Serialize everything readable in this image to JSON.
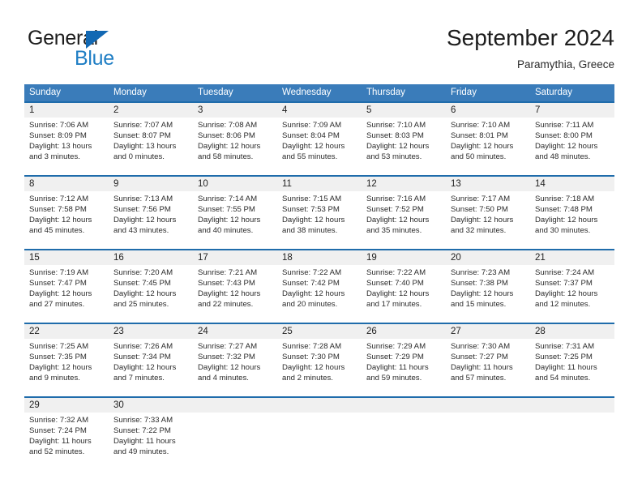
{
  "brand": {
    "name_part1": "General",
    "name_part2": "Blue",
    "logo_color": "#1268b3"
  },
  "header": {
    "title": "September 2024",
    "location": "Paramythia, Greece"
  },
  "theme": {
    "header_blue": "#3a7cba",
    "separator_blue": "#1f6cab",
    "daynum_band": "#f0f0f0"
  },
  "weekdays": [
    "Sunday",
    "Monday",
    "Tuesday",
    "Wednesday",
    "Thursday",
    "Friday",
    "Saturday"
  ],
  "weeks": [
    {
      "days": [
        {
          "num": "1",
          "sunrise": "Sunrise: 7:06 AM",
          "sunset": "Sunset: 8:09 PM",
          "daylight": "Daylight: 13 hours and 3 minutes."
        },
        {
          "num": "2",
          "sunrise": "Sunrise: 7:07 AM",
          "sunset": "Sunset: 8:07 PM",
          "daylight": "Daylight: 13 hours and 0 minutes."
        },
        {
          "num": "3",
          "sunrise": "Sunrise: 7:08 AM",
          "sunset": "Sunset: 8:06 PM",
          "daylight": "Daylight: 12 hours and 58 minutes."
        },
        {
          "num": "4",
          "sunrise": "Sunrise: 7:09 AM",
          "sunset": "Sunset: 8:04 PM",
          "daylight": "Daylight: 12 hours and 55 minutes."
        },
        {
          "num": "5",
          "sunrise": "Sunrise: 7:10 AM",
          "sunset": "Sunset: 8:03 PM",
          "daylight": "Daylight: 12 hours and 53 minutes."
        },
        {
          "num": "6",
          "sunrise": "Sunrise: 7:10 AM",
          "sunset": "Sunset: 8:01 PM",
          "daylight": "Daylight: 12 hours and 50 minutes."
        },
        {
          "num": "7",
          "sunrise": "Sunrise: 7:11 AM",
          "sunset": "Sunset: 8:00 PM",
          "daylight": "Daylight: 12 hours and 48 minutes."
        }
      ]
    },
    {
      "days": [
        {
          "num": "8",
          "sunrise": "Sunrise: 7:12 AM",
          "sunset": "Sunset: 7:58 PM",
          "daylight": "Daylight: 12 hours and 45 minutes."
        },
        {
          "num": "9",
          "sunrise": "Sunrise: 7:13 AM",
          "sunset": "Sunset: 7:56 PM",
          "daylight": "Daylight: 12 hours and 43 minutes."
        },
        {
          "num": "10",
          "sunrise": "Sunrise: 7:14 AM",
          "sunset": "Sunset: 7:55 PM",
          "daylight": "Daylight: 12 hours and 40 minutes."
        },
        {
          "num": "11",
          "sunrise": "Sunrise: 7:15 AM",
          "sunset": "Sunset: 7:53 PM",
          "daylight": "Daylight: 12 hours and 38 minutes."
        },
        {
          "num": "12",
          "sunrise": "Sunrise: 7:16 AM",
          "sunset": "Sunset: 7:52 PM",
          "daylight": "Daylight: 12 hours and 35 minutes."
        },
        {
          "num": "13",
          "sunrise": "Sunrise: 7:17 AM",
          "sunset": "Sunset: 7:50 PM",
          "daylight": "Daylight: 12 hours and 32 minutes."
        },
        {
          "num": "14",
          "sunrise": "Sunrise: 7:18 AM",
          "sunset": "Sunset: 7:48 PM",
          "daylight": "Daylight: 12 hours and 30 minutes."
        }
      ]
    },
    {
      "days": [
        {
          "num": "15",
          "sunrise": "Sunrise: 7:19 AM",
          "sunset": "Sunset: 7:47 PM",
          "daylight": "Daylight: 12 hours and 27 minutes."
        },
        {
          "num": "16",
          "sunrise": "Sunrise: 7:20 AM",
          "sunset": "Sunset: 7:45 PM",
          "daylight": "Daylight: 12 hours and 25 minutes."
        },
        {
          "num": "17",
          "sunrise": "Sunrise: 7:21 AM",
          "sunset": "Sunset: 7:43 PM",
          "daylight": "Daylight: 12 hours and 22 minutes."
        },
        {
          "num": "18",
          "sunrise": "Sunrise: 7:22 AM",
          "sunset": "Sunset: 7:42 PM",
          "daylight": "Daylight: 12 hours and 20 minutes."
        },
        {
          "num": "19",
          "sunrise": "Sunrise: 7:22 AM",
          "sunset": "Sunset: 7:40 PM",
          "daylight": "Daylight: 12 hours and 17 minutes."
        },
        {
          "num": "20",
          "sunrise": "Sunrise: 7:23 AM",
          "sunset": "Sunset: 7:38 PM",
          "daylight": "Daylight: 12 hours and 15 minutes."
        },
        {
          "num": "21",
          "sunrise": "Sunrise: 7:24 AM",
          "sunset": "Sunset: 7:37 PM",
          "daylight": "Daylight: 12 hours and 12 minutes."
        }
      ]
    },
    {
      "days": [
        {
          "num": "22",
          "sunrise": "Sunrise: 7:25 AM",
          "sunset": "Sunset: 7:35 PM",
          "daylight": "Daylight: 12 hours and 9 minutes."
        },
        {
          "num": "23",
          "sunrise": "Sunrise: 7:26 AM",
          "sunset": "Sunset: 7:34 PM",
          "daylight": "Daylight: 12 hours and 7 minutes."
        },
        {
          "num": "24",
          "sunrise": "Sunrise: 7:27 AM",
          "sunset": "Sunset: 7:32 PM",
          "daylight": "Daylight: 12 hours and 4 minutes."
        },
        {
          "num": "25",
          "sunrise": "Sunrise: 7:28 AM",
          "sunset": "Sunset: 7:30 PM",
          "daylight": "Daylight: 12 hours and 2 minutes."
        },
        {
          "num": "26",
          "sunrise": "Sunrise: 7:29 AM",
          "sunset": "Sunset: 7:29 PM",
          "daylight": "Daylight: 11 hours and 59 minutes."
        },
        {
          "num": "27",
          "sunrise": "Sunrise: 7:30 AM",
          "sunset": "Sunset: 7:27 PM",
          "daylight": "Daylight: 11 hours and 57 minutes."
        },
        {
          "num": "28",
          "sunrise": "Sunrise: 7:31 AM",
          "sunset": "Sunset: 7:25 PM",
          "daylight": "Daylight: 11 hours and 54 minutes."
        }
      ]
    },
    {
      "days": [
        {
          "num": "29",
          "sunrise": "Sunrise: 7:32 AM",
          "sunset": "Sunset: 7:24 PM",
          "daylight": "Daylight: 11 hours and 52 minutes."
        },
        {
          "num": "30",
          "sunrise": "Sunrise: 7:33 AM",
          "sunset": "Sunset: 7:22 PM",
          "daylight": "Daylight: 11 hours and 49 minutes."
        },
        {
          "num": "",
          "sunrise": "",
          "sunset": "",
          "daylight": ""
        },
        {
          "num": "",
          "sunrise": "",
          "sunset": "",
          "daylight": ""
        },
        {
          "num": "",
          "sunrise": "",
          "sunset": "",
          "daylight": ""
        },
        {
          "num": "",
          "sunrise": "",
          "sunset": "",
          "daylight": ""
        },
        {
          "num": "",
          "sunrise": "",
          "sunset": "",
          "daylight": ""
        }
      ]
    }
  ]
}
